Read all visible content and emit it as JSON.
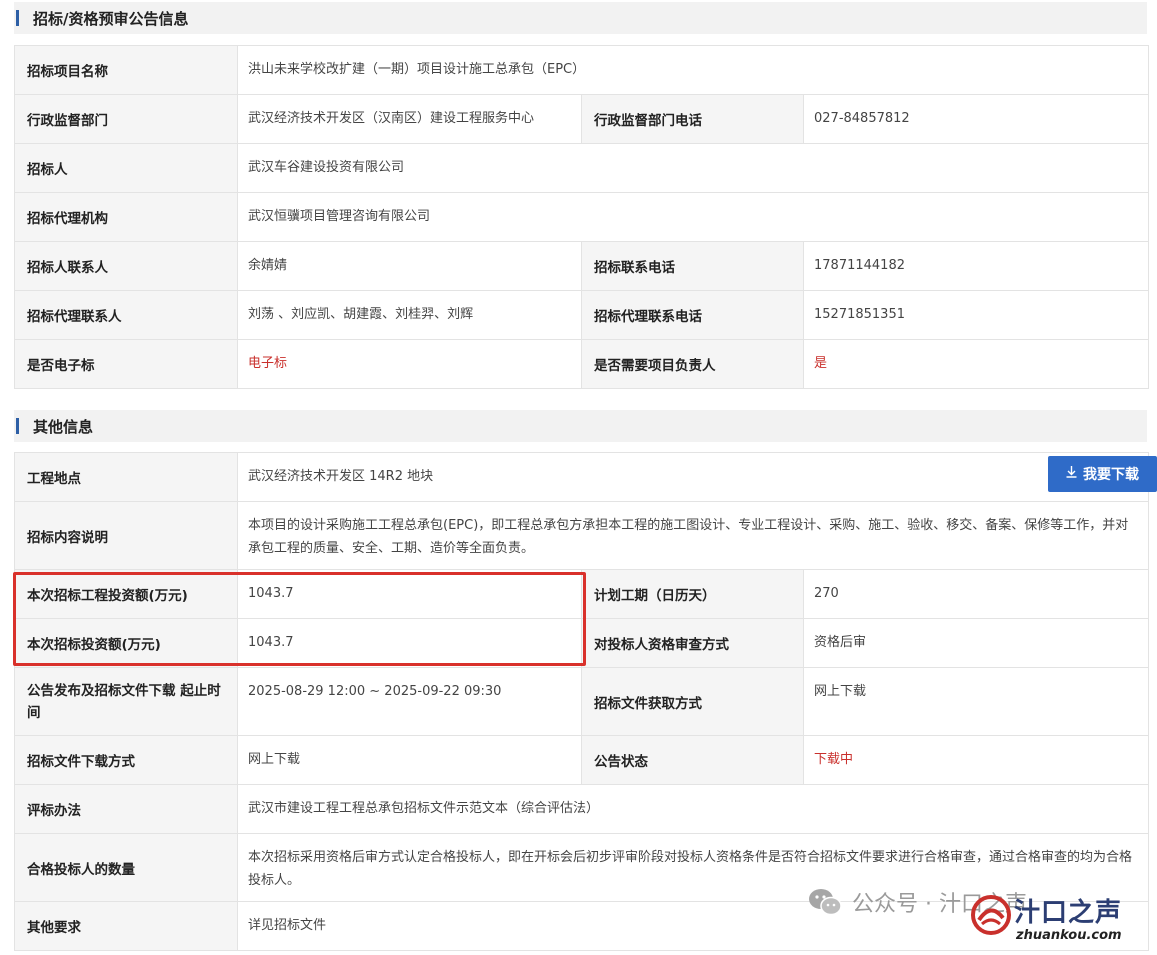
{
  "section1": {
    "title": "招标/资格预审公告信息",
    "rows": {
      "project_name_label": "招标项目名称",
      "project_name": "洪山未来学校改扩建（一期）项目设计施工总承包（EPC）",
      "admin_dept_label": "行政监督部门",
      "admin_dept": "武汉经济技术开发区（汉南区）建设工程服务中心",
      "admin_phone_label": "行政监督部门电话",
      "admin_phone": "027-84857812",
      "tenderer_label": "招标人",
      "tenderer": "武汉车谷建设投资有限公司",
      "agency_label": "招标代理机构",
      "agency": "武汉恒骥项目管理咨询有限公司",
      "tenderer_contact_label": "招标人联系人",
      "tenderer_contact": "余婧婧",
      "tender_phone_label": "招标联系电话",
      "tender_phone": "17871144182",
      "agency_contact_label": "招标代理联系人",
      "agency_contact": "刘荡 、刘应凯、胡建霞、刘桂羿、刘辉",
      "agency_phone_label": "招标代理联系电话",
      "agency_phone": "15271851351",
      "electronic_label": "是否电子标",
      "electronic": "电子标",
      "need_manager_label": "是否需要项目负责人",
      "need_manager": "是"
    }
  },
  "section2": {
    "title": "其他信息",
    "rows": {
      "location_label": "工程地点",
      "location": "武汉经济技术开发区 14R2 地块",
      "content_label": "招标内容说明",
      "content": "本项目的设计采购施工工程总承包(EPC)，即工程总承包方承担本工程的施工图设计、专业工程设计、采购、施工、验收、移交、备案、保修等工作，并对承包工程的质量、安全、工期、造价等全面负责。",
      "invest_project_label": "本次招标工程投资额(万元)",
      "invest_project": "1043.7",
      "period_label": "计划工期（日历天）",
      "period": "270",
      "invest_label": "本次招标投资额(万元)",
      "invest": "1043.7",
      "qual_method_label": "对投标人资格审查方式",
      "qual_method": "资格后审",
      "publish_time_label": "公告发布及招标文件下载 起止时间",
      "publish_time": "2025-08-29 12:00 ~ 2025-09-22 09:30",
      "obtain_method_label": "招标文件获取方式",
      "obtain_method": "网上下载",
      "download_method_label": "招标文件下载方式",
      "download_method": "网上下载",
      "status_label": "公告状态",
      "status": "下载中",
      "eval_label": "评标办法",
      "eval": "武汉市建设工程工程总承包招标文件示范文本（综合评估法）",
      "qualified_count_label": "合格投标人的数量",
      "qualified_count": "本次招标采用资格后审方式认定合格投标人，即在开标会后初步评审阶段对投标人资格条件是否符合招标文件要求进行合格审查，通过合格审查的均为合格投标人。",
      "other_label": "其他要求",
      "other": "详见招标文件"
    }
  },
  "download_button": {
    "label": "我要下载",
    "icon": "download-icon"
  },
  "watermark": {
    "text": "公众号 · 汁口之声"
  },
  "logo": {
    "brand": "汁口之声",
    "domain": "zhuankou.com"
  },
  "colors": {
    "accent_bar": "#2d5fa6",
    "button": "#2f6bc8",
    "red_text": "#c9302c",
    "highlight": "#d9312b"
  }
}
